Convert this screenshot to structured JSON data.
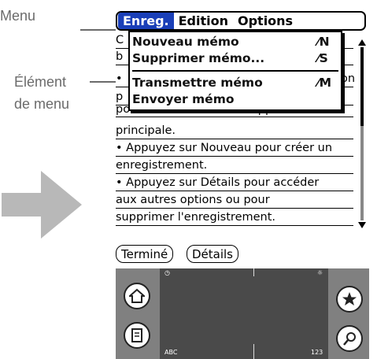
{
  "callouts": {
    "menu": "Menu",
    "element_line1": "Élément",
    "element_line2": "de menu"
  },
  "menubar": {
    "items": [
      "Enreg.",
      "Edition",
      "Options"
    ],
    "active": "Enreg."
  },
  "dropdown": {
    "items": [
      {
        "label": "Nouveau mémo",
        "shortcut": "N"
      },
      {
        "label": "Supprimer mémo...",
        "shortcut": "S"
      },
      {
        "label": "Transmettre mémo",
        "shortcut": "M"
      },
      {
        "label": "Envoyer mémo",
        "shortcut": ""
      }
    ]
  },
  "body": {
    "lines": [
      "C",
      "b",
      "•",
      "p",
      "poche et démarrer une application",
      "principale.",
      "• Appuyez sur Nouveau pour créer un",
      "enregistrement.",
      "• Appuyez sur Détails pour accéder",
      "aux autres options ou pour",
      "supprimer l'enregistrement."
    ],
    "right_fragment": "on"
  },
  "buttons": {
    "done": "Terminé",
    "details": "Détails"
  },
  "graffiti": {
    "left_label": "ABC",
    "right_label": "123",
    "icons": [
      "home-icon",
      "menu-icon",
      "favorites-icon",
      "find-icon",
      "clock-icon",
      "brightness-icon"
    ]
  },
  "colors": {
    "menu_highlight": "#1a3fb8",
    "arrow": "#b8b8b8",
    "callout_text": "#6b6b6b",
    "graffiti_bg": "#808080",
    "graffiti_pad": "#4a4a4a"
  }
}
